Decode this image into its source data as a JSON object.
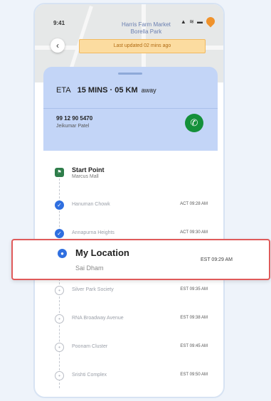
{
  "status_bar": {
    "time": "9:41",
    "icons": "▲ ≋ ▬"
  },
  "map": {
    "place_label": "Harris Farm Market\nBorella Park"
  },
  "banner": {
    "text": "Last updated 02 mins ago"
  },
  "eta": {
    "prefix": "ETA",
    "value": "15 MINS · 05 KM",
    "suffix": "away"
  },
  "driver": {
    "phone": "99 12 90 5470",
    "name": "Jeikumar Patel"
  },
  "route": {
    "start": {
      "label": "Start Point",
      "sub": "Marcus Mall"
    },
    "stops": [
      {
        "name": "Hanuman Chowk",
        "time": "ACT 09:28 AM",
        "status": "done"
      },
      {
        "name": "Annapurna Heights",
        "time": "ACT 09:30 AM",
        "status": "done"
      },
      {
        "name": "Silver Park Society",
        "time": "EST 09:35 AM",
        "status": "pending"
      },
      {
        "name": "RNA Broadway Avenue",
        "time": "EST 09:38 AM",
        "status": "pending"
      },
      {
        "name": "Poonam Cluster",
        "time": "EST 09:45 AM",
        "status": "pending"
      },
      {
        "name": "Srishti Complex",
        "time": "EST 09:50 AM",
        "status": "pending"
      }
    ]
  },
  "current_stop": {
    "name": "My Location",
    "sub": "Sai Dham",
    "time": "EST 09:29 AM"
  },
  "colors": {
    "accent": "#2f6fe0",
    "eta_bg": "#c3d5f7",
    "call": "#14903a",
    "highlight_border": "#e05a5a",
    "banner_bg": "#fcdca0"
  }
}
